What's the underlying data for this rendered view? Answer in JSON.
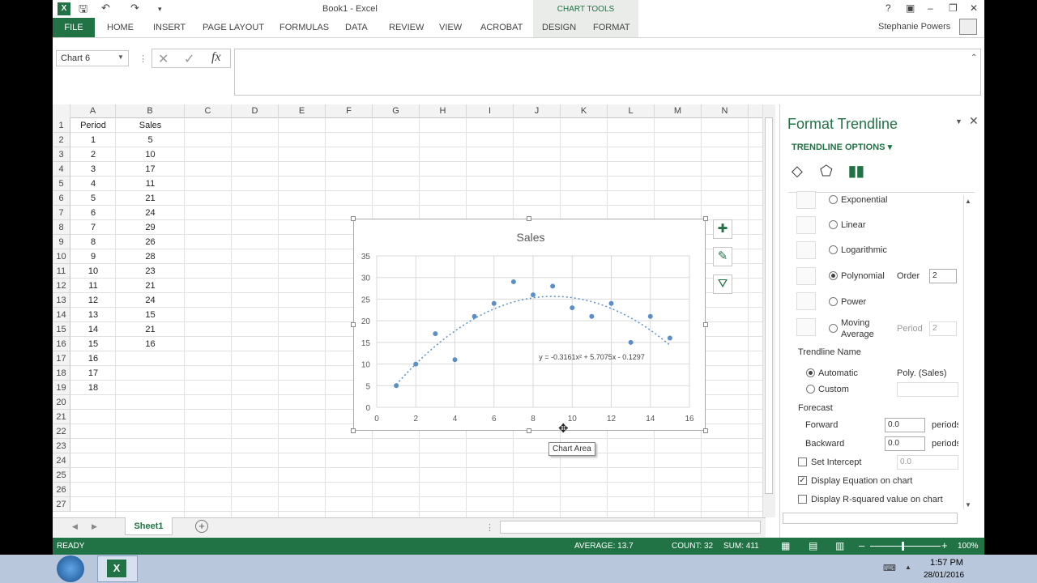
{
  "window": {
    "title": "Book1 - Excel",
    "chart_tools": "CHART TOOLS",
    "user": "Stephanie Powers"
  },
  "tabs": [
    "FILE",
    "HOME",
    "INSERT",
    "PAGE LAYOUT",
    "FORMULAS",
    "DATA",
    "REVIEW",
    "VIEW",
    "ACROBAT",
    "DESIGN",
    "FORMAT"
  ],
  "formula_bar": {
    "name_box": "Chart 6",
    "fx": "fx"
  },
  "columns": [
    "A",
    "B",
    "C",
    "D",
    "E",
    "F",
    "G",
    "H",
    "I",
    "J",
    "K",
    "L",
    "M",
    "N"
  ],
  "rows": [
    "1",
    "2",
    "3",
    "4",
    "5",
    "6",
    "7",
    "8",
    "9",
    "10",
    "11",
    "12",
    "13",
    "14",
    "15",
    "16",
    "17",
    "18",
    "19",
    "20",
    "21",
    "22",
    "23",
    "24",
    "25",
    "26",
    "27"
  ],
  "table": {
    "headers": [
      "Period",
      "Sales"
    ],
    "periods": [
      "1",
      "2",
      "3",
      "4",
      "5",
      "6",
      "7",
      "8",
      "9",
      "10",
      "11",
      "12",
      "13",
      "14",
      "15",
      "16",
      "17",
      "18"
    ],
    "sales": [
      "5",
      "10",
      "17",
      "11",
      "21",
      "24",
      "29",
      "26",
      "28",
      "23",
      "21",
      "24",
      "15",
      "21",
      "16"
    ]
  },
  "sheet": {
    "tab": "Sheet1",
    "add": "+"
  },
  "chart_data": {
    "type": "scatter",
    "title": "Sales",
    "x": [
      1,
      2,
      3,
      4,
      5,
      6,
      7,
      8,
      9,
      10,
      11,
      12,
      13,
      14,
      15
    ],
    "y": [
      5,
      10,
      17,
      11,
      21,
      24,
      29,
      26,
      28,
      23,
      21,
      24,
      15,
      21,
      16
    ],
    "xlim": [
      0,
      16
    ],
    "ylim": [
      0,
      35
    ],
    "x_ticks": [
      "0",
      "2",
      "4",
      "6",
      "8",
      "10",
      "12",
      "14",
      "16"
    ],
    "y_ticks": [
      "0",
      "5",
      "10",
      "15",
      "20",
      "25",
      "30",
      "35"
    ],
    "grid": true,
    "trendline": {
      "type": "polynomial",
      "coefficients": [
        -0.3161,
        5.7075,
        -0.1297
      ],
      "equation": "y = -0.3161x² + 5.7075x - 0.1297"
    },
    "point_color": "#5b8fc7"
  },
  "tooltip": "Chart Area",
  "pane": {
    "title": "Format Trendline",
    "section": "TRENDLINE OPTIONS",
    "options": {
      "exponential": "Exponential",
      "linear": "Linear",
      "logarithmic": "Logarithmic",
      "polynomial": "Polynomial",
      "power": "Power",
      "moving_average_1": "Moving",
      "moving_average_2": "Average"
    },
    "order_label": "Order",
    "order_value": "2",
    "period_label": "Period",
    "period_value": "2",
    "trendline_name": "Trendline Name",
    "automatic": "Automatic",
    "automatic_value": "Poly. (Sales)",
    "custom": "Custom",
    "forecast": "Forecast",
    "forward": "Forward",
    "forward_value": "0.0",
    "backward": "Backward",
    "backward_value": "0.0",
    "periods": "periods",
    "set_intercept": "Set Intercept",
    "intercept_value": "0.0",
    "display_equation": "Display Equation on chart",
    "display_r2": "Display R-squared value on chart"
  },
  "status": {
    "ready": "READY",
    "average": "AVERAGE: 13.7",
    "count": "COUNT: 32",
    "sum": "SUM: 411",
    "zoom": "100%"
  },
  "taskbar": {
    "time": "1:57 PM",
    "date": "28/01/2016"
  },
  "colors": {
    "excel_green": "#217346"
  }
}
